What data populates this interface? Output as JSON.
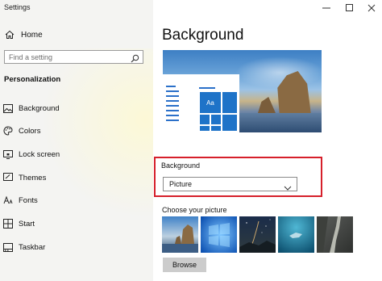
{
  "window": {
    "title": "Settings",
    "minimize_icon": "minimize-icon",
    "maximize_icon": "maximize-icon",
    "close_icon": "close-icon"
  },
  "sidebar": {
    "home_label": "Home",
    "search_placeholder": "Find a setting",
    "section_title": "Personalization",
    "items": [
      {
        "label": "Background",
        "icon": "picture-icon"
      },
      {
        "label": "Colors",
        "icon": "palette-icon"
      },
      {
        "label": "Lock screen",
        "icon": "lock-screen-icon"
      },
      {
        "label": "Themes",
        "icon": "brush-icon"
      },
      {
        "label": "Fonts",
        "icon": "font-icon"
      },
      {
        "label": "Start",
        "icon": "start-icon"
      },
      {
        "label": "Taskbar",
        "icon": "taskbar-icon"
      }
    ]
  },
  "main": {
    "page_title": "Background",
    "preview_tile_label": "Aa",
    "background_label": "Background",
    "background_value": "Picture",
    "choose_picture_label": "Choose your picture",
    "browse_label": "Browse"
  },
  "colors": {
    "accent": "#1e73c8",
    "highlight_border": "#d6202b",
    "sidebar_bg": "#f4f4f2"
  }
}
